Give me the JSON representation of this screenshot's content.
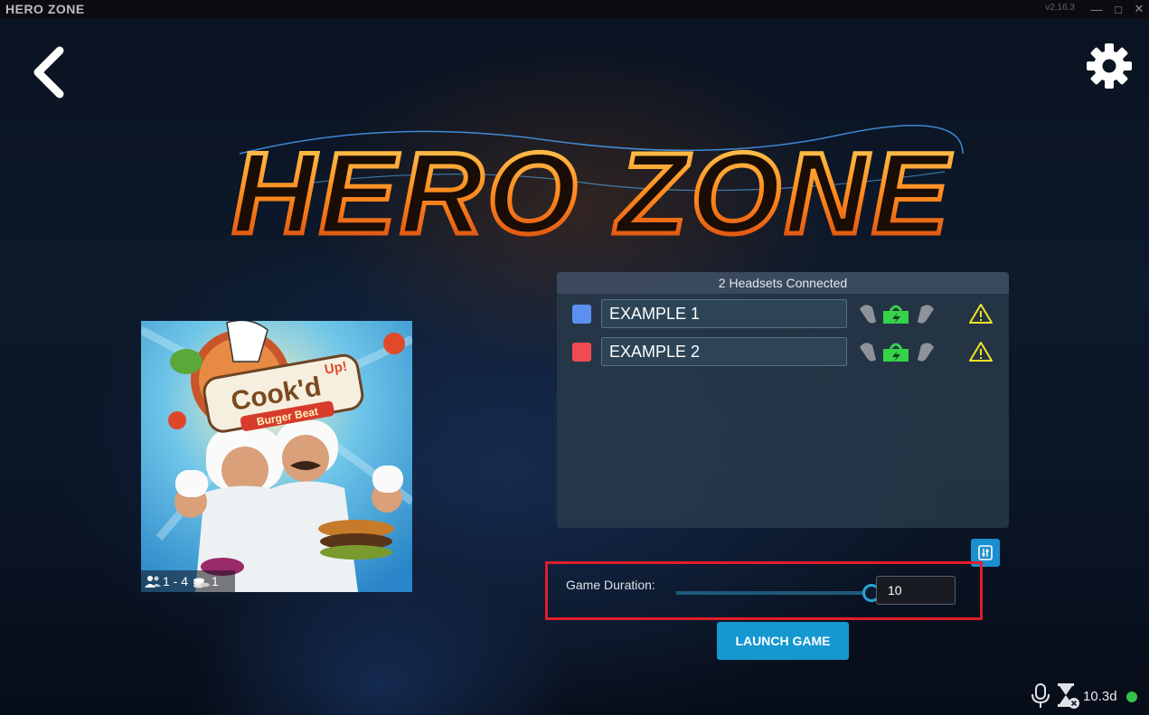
{
  "titlebar": {
    "app_title": "HERO ZONE",
    "version": "v2.16.3",
    "minimize_icon": "minimize-icon",
    "maximize_icon": "maximize-icon",
    "close_icon": "close-icon"
  },
  "nav": {
    "back_icon": "chevron-left-icon",
    "settings_icon": "gear-icon"
  },
  "logo": {
    "text": "HERO ZONE"
  },
  "game": {
    "title_line1": "Cook'd",
    "title_badge": "Up!",
    "subtitle": "Burger Beat",
    "players": "1 - 4",
    "credits": "1"
  },
  "headsets": {
    "header": "2 Headsets Connected",
    "items": [
      {
        "name": "EXAMPLE 1",
        "color": "#5b8ff0"
      },
      {
        "name": "EXAMPLE 2",
        "color": "#ef4b50"
      }
    ]
  },
  "duration": {
    "label": "Game Duration:",
    "value": "10",
    "slider_level": 1.0
  },
  "launch": {
    "label": "LAUNCH GAME"
  },
  "status": {
    "text": "10.3d",
    "online_color": "#36c14a"
  }
}
